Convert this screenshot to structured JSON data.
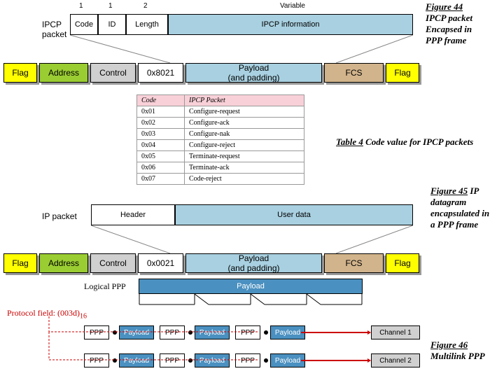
{
  "fig44": {
    "title": "Figure 44",
    "l1": "IPCP packet",
    "l2": "Encapsed in",
    "l3": " PPP frame"
  },
  "fig45": {
    "title": "Figure 45",
    "l1": "IP",
    "l2": "datagram",
    "l3": " encapsulated in",
    "l4": " a PPP frame"
  },
  "fig46": {
    "title": "Figure 46",
    "l1": "Multilink PPP"
  },
  "table4cap": {
    "a": "Table 4",
    "b": "  Code value  for  IPCP packets"
  },
  "ipcp": {
    "label": "IPCP\npacket",
    "ticks": [
      "1",
      "1",
      "2",
      "Variable"
    ],
    "fields": [
      "Code",
      "ID",
      "Length",
      "IPCP information"
    ]
  },
  "frame1": {
    "fields": [
      "Flag",
      "Address",
      "Control",
      "0x8021",
      "Payload\n(and padding)",
      "FCS",
      "Flag"
    ]
  },
  "codetable": {
    "h1": "Code",
    "h2": "IPCP Packet",
    "rows": [
      [
        "0x01",
        "Configure-request"
      ],
      [
        "0x02",
        "Configure-ack"
      ],
      [
        "0x03",
        "Configure-nak"
      ],
      [
        "0x04",
        "Configure-reject"
      ],
      [
        "0x05",
        "Terminate-request"
      ],
      [
        "0x06",
        "Terminate-ack"
      ],
      [
        "0x07",
        "Code-reject"
      ]
    ]
  },
  "ippkt": {
    "label": "IP packet",
    "fields": [
      "Header",
      "User data"
    ]
  },
  "frame2": {
    "fields": [
      "Flag",
      "Address",
      "Control",
      "0x0021",
      "Payload\n(and padding)",
      "FCS",
      "Flag"
    ]
  },
  "multi": {
    "logical_ppp": "Logical PPP",
    "payload": "Payload",
    "protofield": "Protocol field: (003d)",
    "proto_sub": "16",
    "ppp": "PPP",
    "pay": "Payload",
    "ch1": "Channel 1",
    "ch2": "Channel 2"
  }
}
